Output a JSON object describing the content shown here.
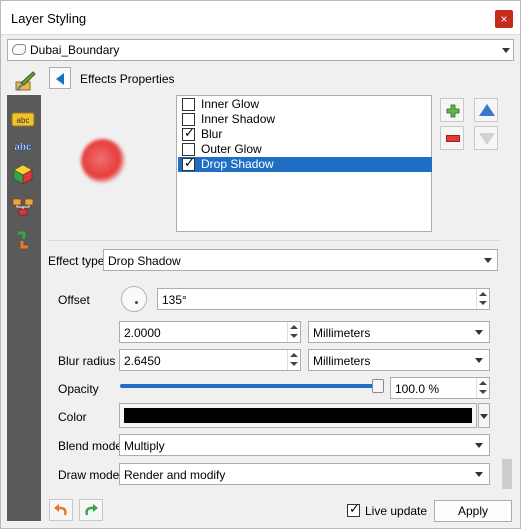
{
  "window": {
    "title": "Layer Styling",
    "close_glyph": "×"
  },
  "layer_selector": {
    "value": "Dubai_Boundary",
    "icon": "polygon-layer-icon"
  },
  "panel": {
    "title": "Effects Properties",
    "back_icon": "back-arrow-icon"
  },
  "sidebar": {
    "icons": [
      "symbology-brush-icon",
      "labels-abc-icon",
      "masks-abc-icon",
      "3d-view-icon",
      "diagrams-icon",
      "history-icon"
    ]
  },
  "effects": [
    {
      "label": "Inner Glow",
      "checked": false,
      "selected": false
    },
    {
      "label": "Inner Shadow",
      "checked": false,
      "selected": false
    },
    {
      "label": "Blur",
      "checked": true,
      "selected": false
    },
    {
      "label": "Outer Glow",
      "checked": false,
      "selected": false
    },
    {
      "label": "Drop Shadow",
      "checked": true,
      "selected": true
    }
  ],
  "preview": {
    "color": "#e63a3a"
  },
  "effect_type": {
    "label": "Effect type",
    "value": "Drop Shadow"
  },
  "offset": {
    "label": "Offset",
    "angle": "135°",
    "distance": "2.0000",
    "unit": "Millimeters"
  },
  "blur_radius": {
    "label": "Blur radius",
    "value": "2.6450",
    "unit": "Millimeters"
  },
  "opacity": {
    "label": "Opacity",
    "value": "100.0 %",
    "fraction": 1.0
  },
  "color": {
    "label": "Color",
    "value": "#000000"
  },
  "blend_mode": {
    "label": "Blend mode",
    "value": "Multiply"
  },
  "draw_mode": {
    "label": "Draw mode",
    "value": "Render and modify"
  },
  "bottom": {
    "live_update_label": "Live update",
    "live_update_checked": true,
    "apply_label": "Apply",
    "undo_icon": "undo-icon",
    "redo_icon": "redo-icon"
  },
  "colors": {
    "accent": "#1e6fc4",
    "sidebar": "#5a5a5a",
    "close": "#c42b1c"
  }
}
